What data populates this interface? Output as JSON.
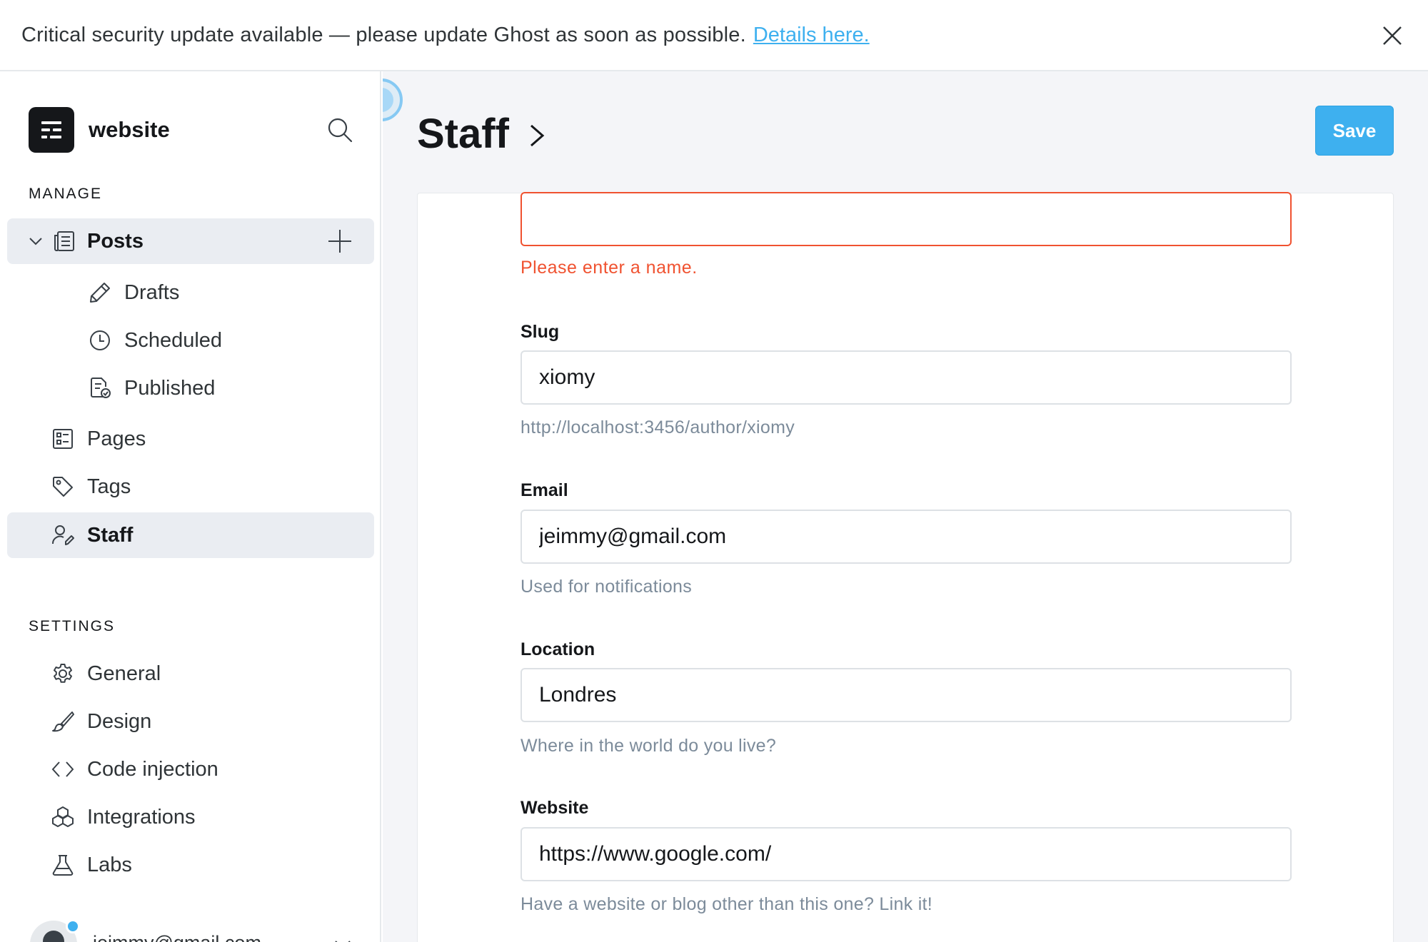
{
  "banner": {
    "message": "Critical security update available — please update Ghost as soon as possible.",
    "link": "Details here."
  },
  "sidebar": {
    "site_name": "website",
    "manage_title": "MANAGE",
    "settings_title": "SETTINGS",
    "posts_label": "Posts",
    "drafts_label": "Drafts",
    "scheduled_label": "Scheduled",
    "published_label": "Published",
    "pages_label": "Pages",
    "tags_label": "Tags",
    "staff_label": "Staff",
    "general_label": "General",
    "design_label": "Design",
    "code_injection_label": "Code injection",
    "integrations_label": "Integrations",
    "labs_label": "Labs",
    "user_email": "jeimmy@gmail.com"
  },
  "header": {
    "title": "Staff",
    "save_label": "Save"
  },
  "form": {
    "name": {
      "value": "",
      "error": "Please enter a name."
    },
    "slug": {
      "label": "Slug",
      "value": "xiomy",
      "hint": "http://localhost:3456/author/xiomy"
    },
    "email": {
      "label": "Email",
      "value": "jeimmy@gmail.com",
      "hint": "Used for notifications"
    },
    "location": {
      "label": "Location",
      "value": "Londres",
      "hint": "Where in the world do you live?"
    },
    "website": {
      "label": "Website",
      "value": "https://www.google.com/",
      "hint": "Have a website or blog other than this one? Link it!"
    }
  },
  "colors": {
    "accent": "#3eb0ef",
    "error": "#f05230",
    "active_bg": "#eaedf2"
  }
}
